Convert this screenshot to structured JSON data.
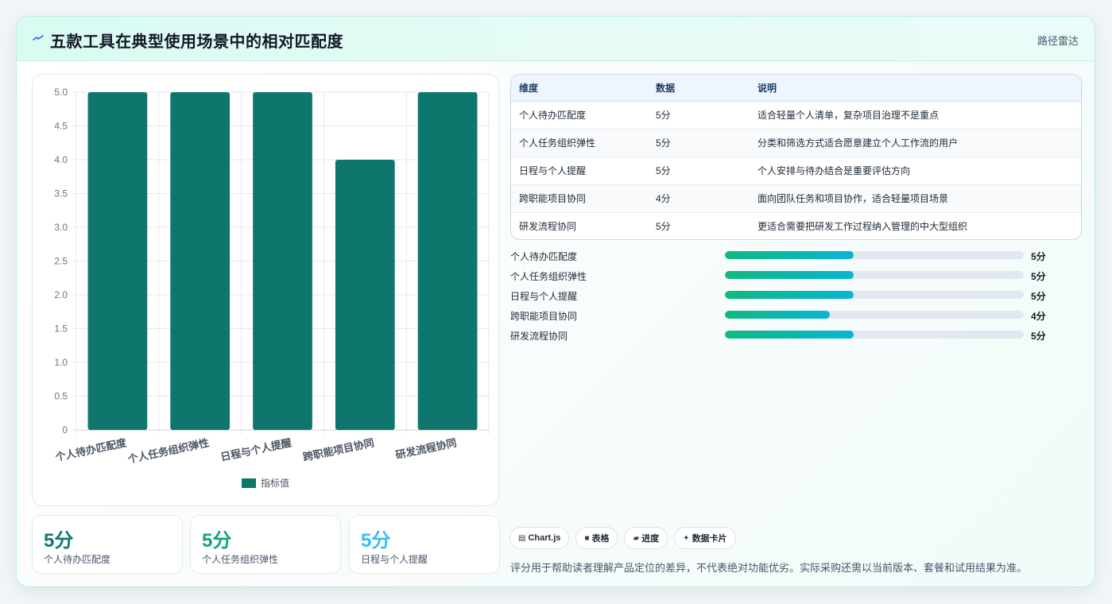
{
  "header": {
    "title": "五款工具在典型使用场景中的相对匹配度",
    "subtitle": "路径雷达",
    "icon": "spark-icon"
  },
  "chart_data": {
    "type": "bar",
    "categories": [
      "个人待办匹配度",
      "个人任务组织弹性",
      "日程与个人提醒",
      "跨职能项目协同",
      "研发流程协同"
    ],
    "series": [
      {
        "name": "指标值",
        "values": [
          5,
          5,
          5,
          4,
          5
        ]
      }
    ],
    "ylim": [
      0,
      5
    ],
    "yticks": [
      "0",
      "0.5",
      "1.0",
      "1.5",
      "2.0",
      "2.5",
      "3.0",
      "3.5",
      "4.0",
      "4.5",
      "5.0"
    ],
    "grid": true,
    "legend": "bottom",
    "bar_color": "#0f766e"
  },
  "stats": [
    {
      "value": "5分",
      "label": "个人待办匹配度",
      "color": "#0f766e"
    },
    {
      "value": "5分",
      "label": "个人任务组织弹性",
      "color": "#10a37f"
    },
    {
      "value": "5分",
      "label": "日程与个人提醒",
      "color": "#38bdf8"
    }
  ],
  "table": {
    "headers": [
      "维度",
      "数据",
      "说明"
    ],
    "rows": [
      [
        "个人待办匹配度",
        "5分",
        "适合轻量个人清单，复杂项目治理不是重点"
      ],
      [
        "个人任务组织弹性",
        "5分",
        "分类和筛选方式适合愿意建立个人工作流的用户"
      ],
      [
        "日程与个人提醒",
        "5分",
        "个人安排与待办结合是重要评估方向"
      ],
      [
        "跨职能项目协同",
        "4分",
        "面向团队任务和项目协作，适合轻量项目场景"
      ],
      [
        "研发流程协同",
        "5分",
        "更适合需要把研发工作过程纳入管理的中大型组织"
      ]
    ]
  },
  "progress": [
    {
      "label": "个人待办匹配度",
      "value": "5分",
      "fraction": 0.43
    },
    {
      "label": "个人任务组织弹性",
      "value": "5分",
      "fraction": 0.43
    },
    {
      "label": "日程与个人提醒",
      "value": "5分",
      "fraction": 0.43
    },
    {
      "label": "跨职能项目协同",
      "value": "4分",
      "fraction": 0.35
    },
    {
      "label": "研发流程协同",
      "value": "5分",
      "fraction": 0.43
    }
  ],
  "tags": [
    {
      "icon": "chart-icon",
      "glyph": "▤",
      "label": "Chart.js"
    },
    {
      "icon": "table-icon",
      "glyph": "■",
      "label": "表格"
    },
    {
      "icon": "folder-icon",
      "glyph": "▰",
      "label": "进度"
    },
    {
      "icon": "sparkle-icon",
      "glyph": "✦",
      "label": "数据卡片"
    }
  ],
  "note": "评分用于帮助读者理解产品定位的差异，不代表绝对功能优劣。实际采购还需以当前版本、套餐和试用结果为准。"
}
